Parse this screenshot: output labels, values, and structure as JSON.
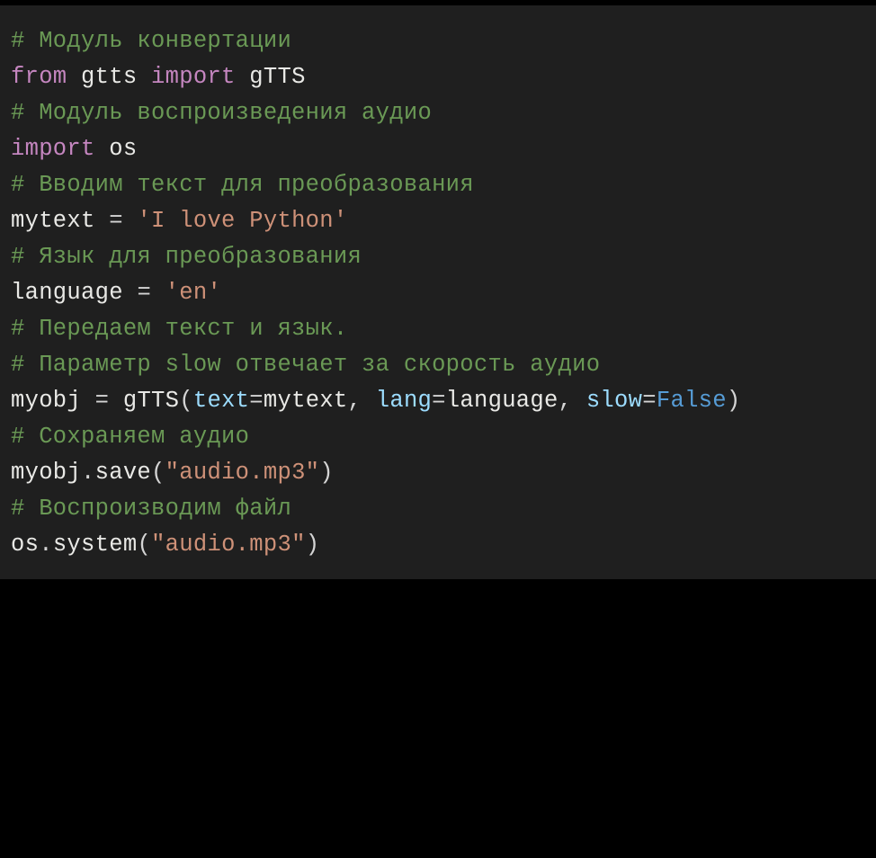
{
  "code": {
    "lines": [
      {
        "tokens": [
          {
            "cls": "c",
            "t": "# Модуль конвертации"
          }
        ]
      },
      {
        "tokens": [
          {
            "cls": "k",
            "t": "from"
          },
          {
            "cls": "id",
            "t": " gtts "
          },
          {
            "cls": "k",
            "t": "import"
          },
          {
            "cls": "id",
            "t": " gTTS"
          }
        ]
      },
      {
        "tokens": [
          {
            "cls": "id",
            "t": ""
          }
        ]
      },
      {
        "tokens": [
          {
            "cls": "c",
            "t": "# Модуль воспроизведения аудио"
          }
        ]
      },
      {
        "tokens": [
          {
            "cls": "k",
            "t": "import"
          },
          {
            "cls": "id",
            "t": " os"
          }
        ]
      },
      {
        "tokens": [
          {
            "cls": "id",
            "t": ""
          }
        ]
      },
      {
        "tokens": [
          {
            "cls": "c",
            "t": "# Вводим текст для преобразования"
          }
        ]
      },
      {
        "tokens": [
          {
            "cls": "id",
            "t": "mytext "
          },
          {
            "cls": "punc",
            "t": "= "
          },
          {
            "cls": "s",
            "t": "'I love Python'"
          }
        ]
      },
      {
        "tokens": [
          {
            "cls": "id",
            "t": ""
          }
        ]
      },
      {
        "tokens": [
          {
            "cls": "c",
            "t": "# Язык для преобразования"
          }
        ]
      },
      {
        "tokens": [
          {
            "cls": "id",
            "t": "language "
          },
          {
            "cls": "punc",
            "t": "= "
          },
          {
            "cls": "s",
            "t": "'en'"
          }
        ]
      },
      {
        "tokens": [
          {
            "cls": "id",
            "t": ""
          }
        ]
      },
      {
        "tokens": [
          {
            "cls": "c",
            "t": "# Передаем текст и язык."
          }
        ]
      },
      {
        "tokens": [
          {
            "cls": "c",
            "t": "# Параметр slow отвечает за скорость аудио"
          }
        ]
      },
      {
        "tokens": [
          {
            "cls": "id",
            "t": "myobj "
          },
          {
            "cls": "punc",
            "t": "= "
          },
          {
            "cls": "fn",
            "t": "gTTS"
          },
          {
            "cls": "punc",
            "t": "("
          },
          {
            "cls": "p",
            "t": "text"
          },
          {
            "cls": "punc",
            "t": "="
          },
          {
            "cls": "id",
            "t": "mytext"
          },
          {
            "cls": "punc",
            "t": ", "
          },
          {
            "cls": "p",
            "t": "lang"
          },
          {
            "cls": "punc",
            "t": "="
          },
          {
            "cls": "id",
            "t": "language"
          },
          {
            "cls": "punc",
            "t": ", "
          },
          {
            "cls": "p",
            "t": "slow"
          },
          {
            "cls": "punc",
            "t": "="
          },
          {
            "cls": "b",
            "t": "False"
          },
          {
            "cls": "punc",
            "t": ")"
          }
        ]
      },
      {
        "tokens": [
          {
            "cls": "id",
            "t": ""
          }
        ]
      },
      {
        "tokens": [
          {
            "cls": "c",
            "t": "# Сохраняем аудио"
          }
        ]
      },
      {
        "tokens": [
          {
            "cls": "id",
            "t": "myobj"
          },
          {
            "cls": "punc",
            "t": "."
          },
          {
            "cls": "fn",
            "t": "save"
          },
          {
            "cls": "punc",
            "t": "("
          },
          {
            "cls": "s",
            "t": "\"audio.mp3\""
          },
          {
            "cls": "punc",
            "t": ")"
          }
        ]
      },
      {
        "tokens": [
          {
            "cls": "id",
            "t": ""
          }
        ]
      },
      {
        "tokens": [
          {
            "cls": "c",
            "t": "# Воспроизводим файл"
          }
        ]
      },
      {
        "tokens": [
          {
            "cls": "id",
            "t": "os"
          },
          {
            "cls": "punc",
            "t": "."
          },
          {
            "cls": "fn",
            "t": "system"
          },
          {
            "cls": "punc",
            "t": "("
          },
          {
            "cls": "s",
            "t": "\"audio.mp3\""
          },
          {
            "cls": "punc",
            "t": ")"
          }
        ]
      }
    ]
  }
}
